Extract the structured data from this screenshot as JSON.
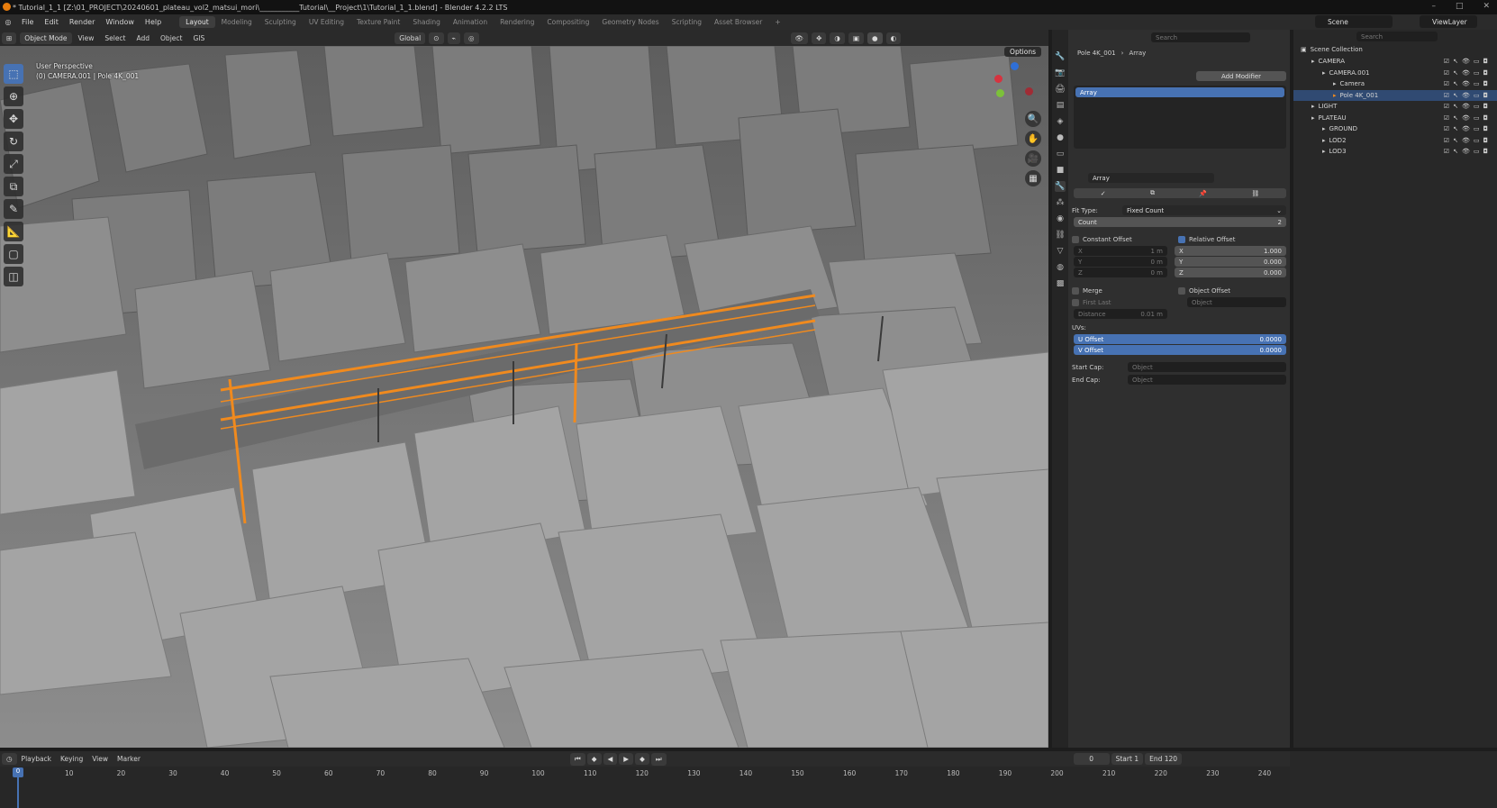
{
  "window": {
    "title": "* Tutorial_1_1 [Z:\\01_PROJECT\\20240601_plateau_vol2_matsui_mori\\___________Tutorial\\__Project\\1\\Tutorial_1_1.blend] - Blender 4.2.2 LTS",
    "minimize": "–",
    "maximize": "□",
    "close": "✕"
  },
  "menu": {
    "items": [
      "File",
      "Edit",
      "Render",
      "Window",
      "Help"
    ],
    "workspaces": [
      "Layout",
      "Modeling",
      "Sculpting",
      "UV Editing",
      "Texture Paint",
      "Shading",
      "Animation",
      "Rendering",
      "Compositing",
      "Geometry Nodes",
      "Scripting",
      "Asset Browser"
    ],
    "add_tab": "+",
    "scene": "Scene",
    "view_layer": "ViewLayer"
  },
  "viewport_header": {
    "mode": "Object Mode",
    "items": [
      "View",
      "Select",
      "Add",
      "Object"
    ],
    "gis": "GIS",
    "transform": "Global",
    "options": "Options"
  },
  "viewport": {
    "perspective": "User Perspective",
    "object": "(0) CAMERA.001 | Pole 4K_001"
  },
  "properties": {
    "search_placeholder": "Search",
    "breadcrumb_object": "Pole 4K_001",
    "breadcrumb_modifier": "Array",
    "add_modifier": "Add Modifier",
    "stack_item": "Array",
    "modifier_name": "Array",
    "fit_type_label": "Fit Type:",
    "fit_type_value": "Fixed Count",
    "count_label": "Count",
    "count_value": "2",
    "constant_offset": "Constant Offset",
    "relative_offset": "Relative Offset",
    "constant": [
      {
        "axis": "X",
        "value": "1 m"
      },
      {
        "axis": "Y",
        "value": "0 m"
      },
      {
        "axis": "Z",
        "value": "0 m"
      }
    ],
    "relative": [
      {
        "axis": "X",
        "value": "1.000"
      },
      {
        "axis": "Y",
        "value": "0.000"
      },
      {
        "axis": "Z",
        "value": "0.000"
      }
    ],
    "merge": "Merge",
    "object_offset": "Object Offset",
    "first_last": "First Last",
    "object_placeholder": "Object",
    "distance_label": "Distance",
    "distance_value": "0.01 m",
    "uvs_label": "UVs:",
    "u_offset_label": "U Offset",
    "u_offset_value": "0.0000",
    "v_offset_label": "V Offset",
    "v_offset_value": "0.0000",
    "start_cap": "Start Cap:",
    "end_cap": "End Cap:",
    "cap_placeholder": "Object"
  },
  "outliner": {
    "search_placeholder": "Search",
    "root": "Scene Collection",
    "rows": [
      {
        "name": "CAMERA",
        "indent": 1,
        "selected": false
      },
      {
        "name": "CAMERA.001",
        "indent": 2,
        "selected": false
      },
      {
        "name": "Camera",
        "indent": 3,
        "selected": false
      },
      {
        "name": "Pole 4K_001",
        "indent": 3,
        "selected": true
      },
      {
        "name": "LIGHT",
        "indent": 1,
        "selected": false
      },
      {
        "name": "PLATEAU",
        "indent": 1,
        "selected": false
      },
      {
        "name": "GROUND",
        "indent": 2,
        "selected": false
      },
      {
        "name": "LOD2",
        "indent": 2,
        "selected": false
      },
      {
        "name": "LOD3",
        "indent": 2,
        "selected": false
      }
    ]
  },
  "timeline": {
    "menu": [
      "Playback",
      "Keying",
      "View",
      "Marker"
    ],
    "current_frame": "0",
    "frame_display": "0",
    "start_label": "Start",
    "start_value": "1",
    "end_label": "End",
    "end_value": "120",
    "ticks": [
      "10",
      "20",
      "30",
      "40",
      "50",
      "60",
      "70",
      "80",
      "90",
      "100",
      "110",
      "120",
      "130",
      "140",
      "150",
      "160",
      "170",
      "180",
      "190",
      "200",
      "210",
      "220",
      "230",
      "240"
    ]
  },
  "colors": {
    "accent": "#4772b3",
    "selection_orange": "#f08a1e",
    "viewport_bg": "#7a7a7a"
  }
}
